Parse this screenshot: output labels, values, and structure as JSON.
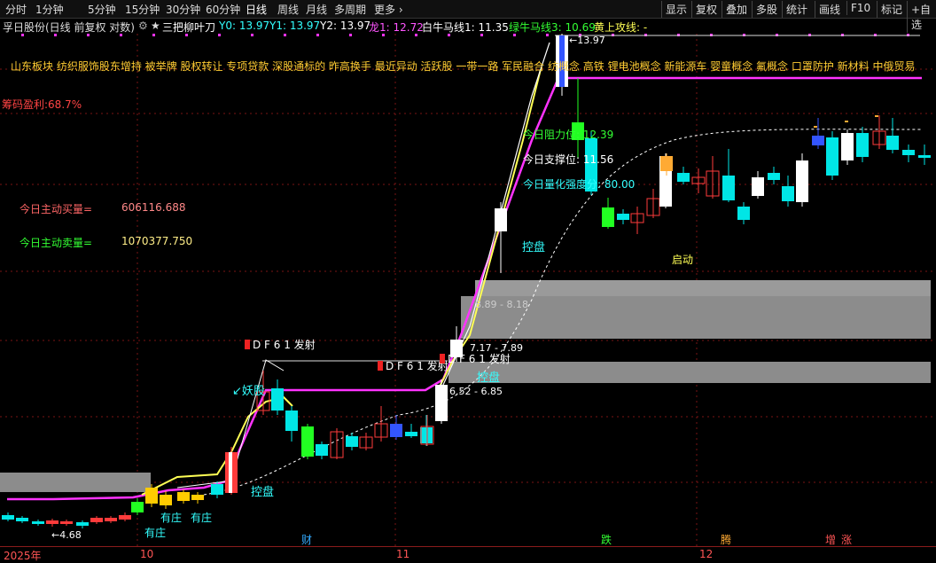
{
  "toolbar": {
    "periods": [
      "分时",
      "1分钟",
      "5分钟",
      "15分钟",
      "30分钟",
      "60分钟",
      "日线",
      "周线",
      "月线",
      "多周期",
      "更多 ›"
    ],
    "right_buttons": [
      "显示",
      "复权",
      "叠加",
      "多股",
      "统计",
      "画线",
      "F10",
      "标记",
      "+自选"
    ]
  },
  "infobar": {
    "stock": "孚日股份(日线 前复权 对数)",
    "indicator": "三把柳叶刀",
    "y0": "Y0: 13.97",
    "y1": "Y1: 13.97",
    "y2": "Y2: 13.97",
    "dragon": "龙1: 12.72",
    "white_line": "白牛马线1: 11.35",
    "green_line": "绿牛马线3: 10.69",
    "yellow_attack": "黄上攻线: -"
  },
  "concepts": "山东板块  纺织服饰股东增持 被举牌 股权转让 专项贷款 深股通标的 昨高换手 最近异动 活跃股  一带一路 军民融合 纺概念 高铁 锂电池概念 新能源车 婴童概念 氟概念 口罩防护 新材料 中俄贸易",
  "labels": {
    "chip_profit": "筹码盈利:68.7%",
    "buy_label": "今日主动买量=",
    "buy_value": "606116.688",
    "sell_label": "今日主动卖量=",
    "sell_value": "1070377.750",
    "resistance": "今日阻力位: 12.39",
    "support": "今日支撑位: 11.56",
    "strength": "今日量化强度分: 80.00",
    "qidong": "启动",
    "top_price": "13.97",
    "low_price": "4.68",
    "band1": "8.89 - 8.18",
    "band2": "7.17 - 7.89",
    "band3": "6.52 - 6.85",
    "df1": "D F 6 1 发射",
    "df2": "D F 6 1 发射",
    "df3": "D F 6 1 发射",
    "kongpan1": "控盘",
    "kongpan2": "控盘",
    "kongpan3": "控盘",
    "yaogu": "妖股",
    "youzhuang1": "有庄",
    "youzhuang2": "有庄",
    "youzhuang3": "有庄"
  },
  "axis": {
    "year": "2025年",
    "m10": "10",
    "m11": "11",
    "m12": "12",
    "cai": "财",
    "die": "跌",
    "teng": "腾",
    "zeng": "增",
    "zhang": "涨"
  },
  "colors": {
    "up": "#ff3b3b",
    "down": "#00e6e6",
    "magenta": "#ff33ff",
    "yellow": "#ffff55",
    "white": "#ffffff",
    "band": "#8c8c8c",
    "label_red": "#ff4444",
    "label_green": "#33ff33"
  }
}
